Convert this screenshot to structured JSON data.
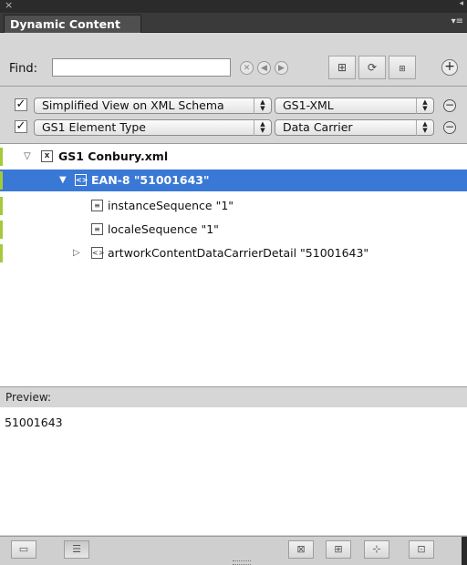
{
  "panel": {
    "title": "Dynamic Content"
  },
  "find": {
    "label": "Find:",
    "value": "",
    "placeholder": ""
  },
  "filters": [
    {
      "checked": true,
      "label": "Simplified View on XML Schema",
      "value": "GS1-XML"
    },
    {
      "checked": true,
      "label": "GS1 Element Type",
      "value": "Data Carrier"
    }
  ],
  "tree": {
    "root": "GS1 Conbury.xml",
    "items": [
      {
        "label": "EAN-8 \"51001643\"",
        "selected": true
      },
      {
        "label": "instanceSequence \"1\""
      },
      {
        "label": "localeSequence \"1\""
      },
      {
        "label": "artworkContentDataCarrierDetail \"51001643\""
      }
    ]
  },
  "preview": {
    "label": "Preview:",
    "text": "51001643"
  },
  "colors": {
    "selection": "#3a78d6",
    "marker": "#a6c93a",
    "header_dark": "#2b2b2b"
  }
}
